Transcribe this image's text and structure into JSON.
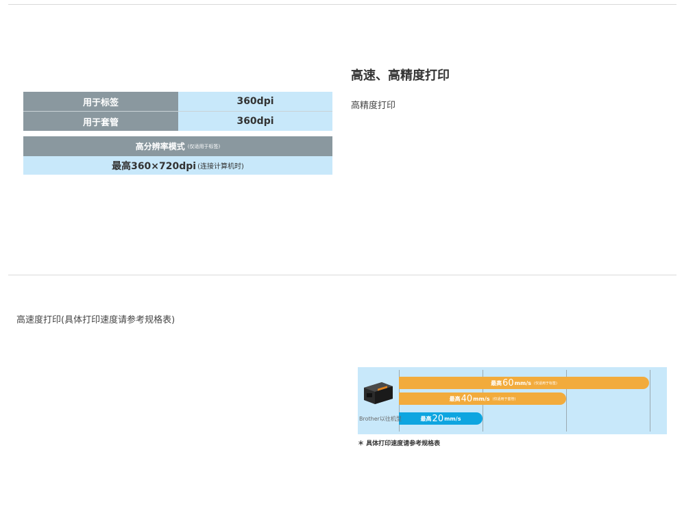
{
  "resolution_table": {
    "rows": [
      {
        "label": "用于标签",
        "value": "360dpi"
      },
      {
        "label": "用于套管",
        "value": "360dpi"
      }
    ],
    "high_res_mode": {
      "title": "高分辨率模式",
      "title_note": "(仅适用于标签)",
      "value": "最高360×720dpi",
      "value_note": "(连接计算机时)"
    }
  },
  "section1": {
    "title": "高速、高精度打印",
    "subtitle": "高精度打印"
  },
  "section2": {
    "subtitle": "高速度打印(具体打印速度请参考规格表)"
  },
  "speed_chart": {
    "printer_label": "Brother以往机型",
    "bars": [
      {
        "prefix": "最高",
        "value": "60",
        "unit": "mm/s",
        "note": "(仅适用于标签)",
        "color": "#f2ab3c",
        "fraction": 1.0
      },
      {
        "prefix": "最高",
        "value": "40",
        "unit": "mm/s",
        "note": "(仅适用于套管)",
        "color": "#f2ab3c",
        "fraction": 0.667
      },
      {
        "prefix": "最高",
        "value": "20",
        "unit": "mm/s",
        "note": "",
        "color": "#0ea5e0",
        "fraction": 0.333
      }
    ],
    "footnote": "＊ 具体打印速度请参考规格表"
  }
}
